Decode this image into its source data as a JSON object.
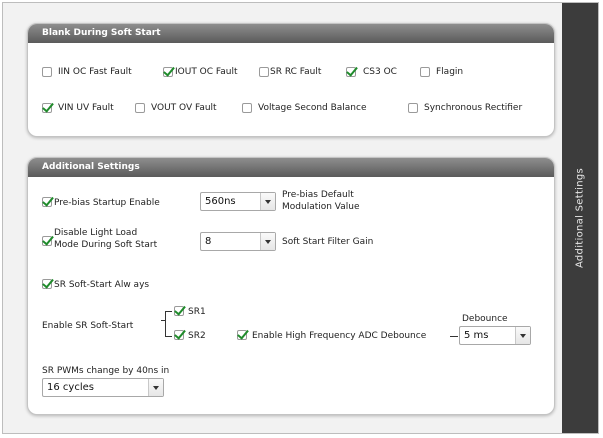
{
  "sidebar": {
    "label": "Additional Settings"
  },
  "blank_panel": {
    "title": "Blank During Soft Start",
    "items": [
      {
        "label": "IIN  OC Fast Fault",
        "checked": false
      },
      {
        "label": "IOUT OC Fault",
        "checked": true
      },
      {
        "label": "SR RC Fault",
        "checked": false
      },
      {
        "label": "CS3 OC",
        "checked": true
      },
      {
        "label": "Flagin",
        "checked": false
      },
      {
        "label": "VIN UV Fault",
        "checked": true
      },
      {
        "label": "VOUT OV Fault",
        "checked": false
      },
      {
        "label": "Voltage Second Balance",
        "checked": false
      },
      {
        "label": "Synchronous Rectifier",
        "checked": false
      }
    ]
  },
  "additional_panel": {
    "title": "Additional Settings",
    "prebias": {
      "label": "Pre-bias Startup Enable",
      "checked": true,
      "select_value": "560ns",
      "select_caption_1": "Pre-bias Default",
      "select_caption_2": "Modulation Value"
    },
    "light_load": {
      "label_1": "Disable Light Load",
      "label_2": "Mode During Soft Start",
      "checked": true,
      "select_value": "8",
      "select_caption": "Soft Start Filter Gain"
    },
    "sr_always": {
      "label": "SR Soft-Start Alw ays",
      "checked": true
    },
    "enable_sr": {
      "label": "Enable SR Soft-Start",
      "sr1": {
        "label": "SR1",
        "checked": true
      },
      "sr2": {
        "label": "SR2",
        "checked": true
      }
    },
    "adc_debounce": {
      "label": "Enable High Frequency ADC Debounce",
      "checked": true,
      "caption": "Debounce",
      "select_value": "5 ms"
    },
    "sr_pwm": {
      "label": "SR PWMs change by 40ns in",
      "select_value": "16 cycles"
    }
  },
  "colors": {
    "header_top": "#8e8e8e",
    "header_bottom": "#5a5a5a",
    "sidebar": "#3c3c3c",
    "check": "#1f8b2b"
  }
}
